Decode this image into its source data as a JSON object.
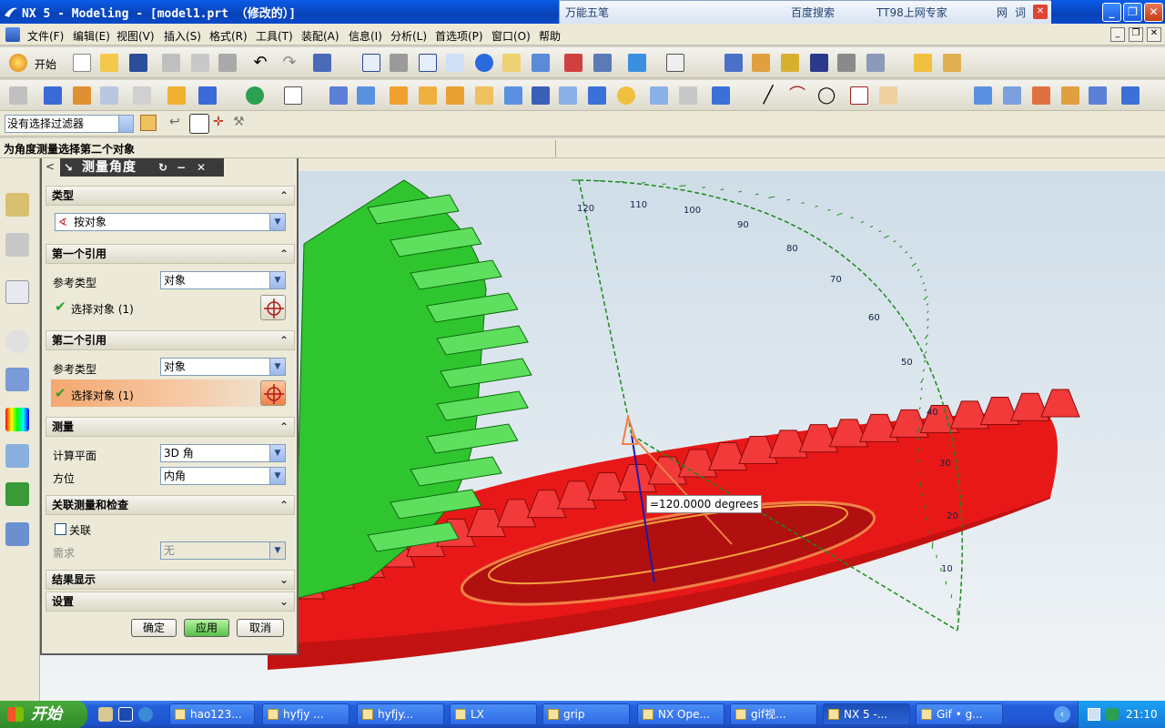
{
  "window": {
    "title": "NX 5 - Modeling - [model1.prt （修改的）]"
  },
  "ime": {
    "tabs": [
      "万能五笔",
      "百度搜索",
      "TT98上网专家",
      "网",
      "词"
    ]
  },
  "menu": [
    "文件(F)",
    "编辑(E)",
    "视图(V)",
    "插入(S)",
    "格式(R)",
    "工具(T)",
    "装配(A)",
    "信息(I)",
    "分析(L)",
    "首选项(P)",
    "窗口(O)",
    "帮助"
  ],
  "toolbar": {
    "start_label": "开始"
  },
  "filter": {
    "value": "没有选择过滤器"
  },
  "status": {
    "message": "为角度测量选择第二个对象"
  },
  "dialog": {
    "title": "测量角度",
    "type": {
      "header": "类型",
      "value": "按对象"
    },
    "first_ref": {
      "header": "第一个引用",
      "ref_type_label": "参考类型",
      "ref_type_value": "对象",
      "select_label": "选择对象 (1)"
    },
    "second_ref": {
      "header": "第二个引用",
      "ref_type_label": "参考类型",
      "ref_type_value": "对象",
      "select_label": "选择对象 (1)"
    },
    "measure": {
      "header": "测量",
      "plane_label": "计算平面",
      "plane_value": "3D 角",
      "dir_label": "方位",
      "dir_value": "内角"
    },
    "assoc": {
      "header": "关联测量和检查",
      "assoc_label": "关联",
      "need_label": "需求",
      "need_value": "无"
    },
    "results": {
      "header": "结果显示"
    },
    "settings": {
      "header": "设置"
    },
    "ok": "确定",
    "apply": "应用",
    "cancel": "取消"
  },
  "viewport": {
    "angle_readout": "=120.0000 degrees",
    "ticks": [
      "120",
      "110",
      "100",
      "90",
      "80",
      "70",
      "60",
      "50",
      "40",
      "30",
      "20",
      "10"
    ]
  },
  "colors": {
    "gear_green": "#2fc52f",
    "gear_red": "#e81818",
    "xp_blue": "#245edb",
    "highlight": "#f08046"
  },
  "taskbar": {
    "start": "开始",
    "tasks": [
      "hao123...",
      "hyfjy ...",
      "hyfjy...",
      "LX",
      "grip",
      "NX Ope...",
      "gif视...",
      "NX 5 -...",
      "Gif • g..."
    ],
    "clock": "21:10"
  }
}
